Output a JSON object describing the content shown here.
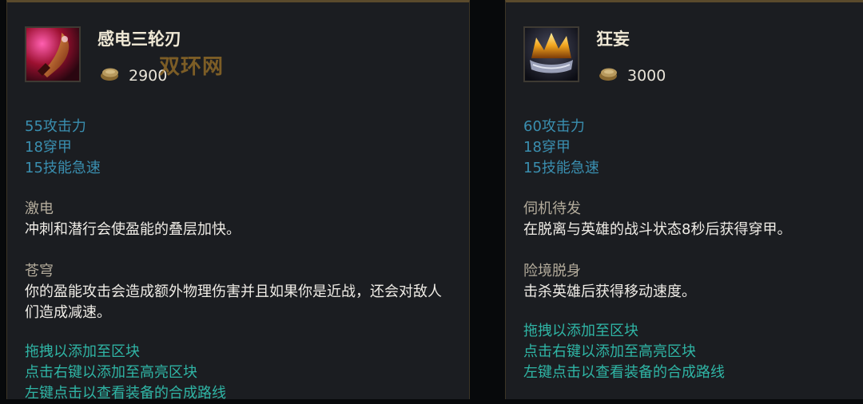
{
  "watermark": "双环网",
  "colors": {
    "stat_text": "#3a8fb0",
    "hint_text": "#2fb5a5",
    "passive_name": "#b3ab9b",
    "body_text": "#efece6",
    "panel_bg": "#1b1d21",
    "panel_border": "#5a4a2c"
  },
  "items": [
    {
      "name": "感电三轮刃",
      "icon": "crimson-blade-icon",
      "cost_icon": "gold-coin-icon",
      "cost": "2900",
      "stats": [
        "55攻击力",
        "18穿甲",
        "15技能急速"
      ],
      "passives": [
        {
          "name": "激电",
          "desc": "冲刺和潜行会使盈能的叠层加快。"
        },
        {
          "name": "苍穹",
          "desc": "你的盈能攻击会造成额外物理伤害并且如果你是近战，还会对敌人们造成减速。"
        }
      ],
      "hints": [
        "拖拽以添加至区块",
        "点击右键以添加至高亮区块",
        "左键点击以查看装备的合成路线"
      ]
    },
    {
      "name": "狂妄",
      "icon": "burning-crown-icon",
      "cost_icon": "gold-coin-icon",
      "cost": "3000",
      "stats": [
        "60攻击力",
        "18穿甲",
        "15技能急速"
      ],
      "passives": [
        {
          "name": "伺机待发",
          "desc": "在脱离与英雄的战斗状态8秒后获得穿甲。"
        },
        {
          "name": "险境脱身",
          "desc": "击杀英雄后获得移动速度。"
        }
      ],
      "hints": [
        "拖拽以添加至区块",
        "点击右键以添加至高亮区块",
        "左键点击以查看装备的合成路线"
      ]
    }
  ]
}
